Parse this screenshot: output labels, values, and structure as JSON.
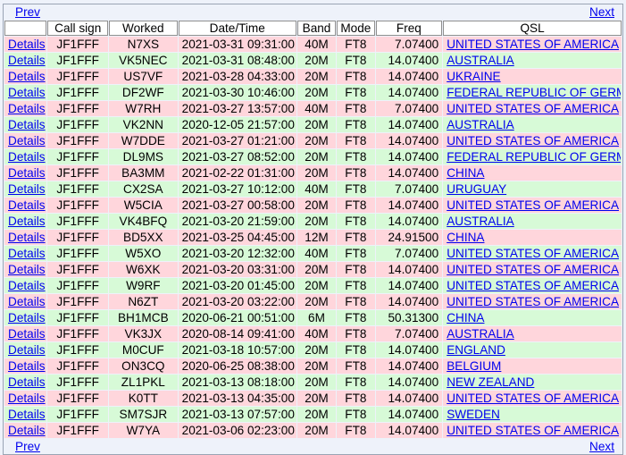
{
  "nav": {
    "prev_label": "Prev",
    "next_label": "Next"
  },
  "columns": [
    "",
    "Call sign",
    "Worked",
    "Date/Time",
    "Band",
    "Mode",
    "Freq",
    "QSL"
  ],
  "rows": [
    {
      "action": "Details",
      "call": "JF1FFF",
      "worked": "N7XS",
      "datetime": "2021-03-31 09:31:00",
      "band": "40M",
      "mode": "FT8",
      "freq": "7.07400",
      "qsl": "UNITED STATES OF AMERICA",
      "color": "pink"
    },
    {
      "action": "Details",
      "call": "JF1FFF",
      "worked": "VK5NEC",
      "datetime": "2021-03-31 08:48:00",
      "band": "20M",
      "mode": "FT8",
      "freq": "14.07400",
      "qsl": "AUSTRALIA",
      "color": "green"
    },
    {
      "action": "Details",
      "call": "JF1FFF",
      "worked": "US7VF",
      "datetime": "2021-03-28 04:33:00",
      "band": "20M",
      "mode": "FT8",
      "freq": "14.07400",
      "qsl": "UKRAINE",
      "color": "pink"
    },
    {
      "action": "Details",
      "call": "JF1FFF",
      "worked": "DF2WF",
      "datetime": "2021-03-30 10:46:00",
      "band": "20M",
      "mode": "FT8",
      "freq": "14.07400",
      "qsl": "FEDERAL REPUBLIC OF GERMANY",
      "color": "green"
    },
    {
      "action": "Details",
      "call": "JF1FFF",
      "worked": "W7RH",
      "datetime": "2021-03-27 13:57:00",
      "band": "40M",
      "mode": "FT8",
      "freq": "7.07400",
      "qsl": "UNITED STATES OF AMERICA",
      "color": "pink"
    },
    {
      "action": "Details",
      "call": "JF1FFF",
      "worked": "VK2NN",
      "datetime": "2020-12-05 21:57:00",
      "band": "20M",
      "mode": "FT8",
      "freq": "14.07400",
      "qsl": "AUSTRALIA",
      "color": "green"
    },
    {
      "action": "Details",
      "call": "JF1FFF",
      "worked": "W7DDE",
      "datetime": "2021-03-27 01:21:00",
      "band": "20M",
      "mode": "FT8",
      "freq": "14.07400",
      "qsl": "UNITED STATES OF AMERICA",
      "color": "pink"
    },
    {
      "action": "Details",
      "call": "JF1FFF",
      "worked": "DL9MS",
      "datetime": "2021-03-27 08:52:00",
      "band": "20M",
      "mode": "FT8",
      "freq": "14.07400",
      "qsl": "FEDERAL REPUBLIC OF GERMANY",
      "color": "green"
    },
    {
      "action": "Details",
      "call": "JF1FFF",
      "worked": "BA3MM",
      "datetime": "2021-02-22 01:31:00",
      "band": "20M",
      "mode": "FT8",
      "freq": "14.07400",
      "qsl": "CHINA",
      "color": "pink"
    },
    {
      "action": "Details",
      "call": "JF1FFF",
      "worked": "CX2SA",
      "datetime": "2021-03-27 10:12:00",
      "band": "40M",
      "mode": "FT8",
      "freq": "7.07400",
      "qsl": "URUGUAY",
      "color": "green"
    },
    {
      "action": "Details",
      "call": "JF1FFF",
      "worked": "W5CIA",
      "datetime": "2021-03-27 00:58:00",
      "band": "20M",
      "mode": "FT8",
      "freq": "14.07400",
      "qsl": "UNITED STATES OF AMERICA",
      "color": "pink"
    },
    {
      "action": "Details",
      "call": "JF1FFF",
      "worked": "VK4BFQ",
      "datetime": "2021-03-20 21:59:00",
      "band": "20M",
      "mode": "FT8",
      "freq": "14.07400",
      "qsl": "AUSTRALIA",
      "color": "green"
    },
    {
      "action": "Details",
      "call": "JF1FFF",
      "worked": "BD5XX",
      "datetime": "2021-03-25 04:45:00",
      "band": "12M",
      "mode": "FT8",
      "freq": "24.91500",
      "qsl": "CHINA",
      "color": "pink"
    },
    {
      "action": "Details",
      "call": "JF1FFF",
      "worked": "W5XO",
      "datetime": "2021-03-20 12:32:00",
      "band": "40M",
      "mode": "FT8",
      "freq": "7.07400",
      "qsl": "UNITED STATES OF AMERICA",
      "color": "green"
    },
    {
      "action": "Details",
      "call": "JF1FFF",
      "worked": "W6XK",
      "datetime": "2021-03-20 03:31:00",
      "band": "20M",
      "mode": "FT8",
      "freq": "14.07400",
      "qsl": "UNITED STATES OF AMERICA",
      "color": "pink"
    },
    {
      "action": "Details",
      "call": "JF1FFF",
      "worked": "W9RF",
      "datetime": "2021-03-20 01:45:00",
      "band": "20M",
      "mode": "FT8",
      "freq": "14.07400",
      "qsl": "UNITED STATES OF AMERICA",
      "color": "green"
    },
    {
      "action": "Details",
      "call": "JF1FFF",
      "worked": "N6ZT",
      "datetime": "2021-03-20 03:22:00",
      "band": "20M",
      "mode": "FT8",
      "freq": "14.07400",
      "qsl": "UNITED STATES OF AMERICA",
      "color": "pink"
    },
    {
      "action": "Details",
      "call": "JF1FFF",
      "worked": "BH1MCB",
      "datetime": "2020-06-21 00:51:00",
      "band": "6M",
      "mode": "FT8",
      "freq": "50.31300",
      "qsl": "CHINA",
      "color": "green"
    },
    {
      "action": "Details",
      "call": "JF1FFF",
      "worked": "VK3JX",
      "datetime": "2020-08-14 09:41:00",
      "band": "40M",
      "mode": "FT8",
      "freq": "7.07400",
      "qsl": "AUSTRALIA",
      "color": "pink"
    },
    {
      "action": "Details",
      "call": "JF1FFF",
      "worked": "M0CUF",
      "datetime": "2021-03-18 10:57:00",
      "band": "20M",
      "mode": "FT8",
      "freq": "14.07400",
      "qsl": "ENGLAND",
      "color": "green"
    },
    {
      "action": "Details",
      "call": "JF1FFF",
      "worked": "ON3CQ",
      "datetime": "2020-06-25 08:38:00",
      "band": "20M",
      "mode": "FT8",
      "freq": "14.07400",
      "qsl": "BELGIUM",
      "color": "pink"
    },
    {
      "action": "Details",
      "call": "JF1FFF",
      "worked": "ZL1PKL",
      "datetime": "2021-03-13 08:18:00",
      "band": "20M",
      "mode": "FT8",
      "freq": "14.07400",
      "qsl": "NEW ZEALAND",
      "color": "green"
    },
    {
      "action": "Details",
      "call": "JF1FFF",
      "worked": "K0TT",
      "datetime": "2021-03-13 04:35:00",
      "band": "20M",
      "mode": "FT8",
      "freq": "14.07400",
      "qsl": "UNITED STATES OF AMERICA",
      "color": "pink"
    },
    {
      "action": "Details",
      "call": "JF1FFF",
      "worked": "SM7SJR",
      "datetime": "2021-03-13 07:57:00",
      "band": "20M",
      "mode": "FT8",
      "freq": "14.07400",
      "qsl": "SWEDEN",
      "color": "green"
    },
    {
      "action": "Details",
      "call": "JF1FFF",
      "worked": "W7YA",
      "datetime": "2021-03-06 02:23:00",
      "band": "20M",
      "mode": "FT8",
      "freq": "14.07400",
      "qsl": "UNITED STATES OF AMERICA",
      "color": "pink"
    }
  ],
  "colors": {
    "pink_row": "#ffd6dc",
    "green_row": "#d7fad7",
    "link": "#0000ee",
    "background": "#eef2fa"
  }
}
